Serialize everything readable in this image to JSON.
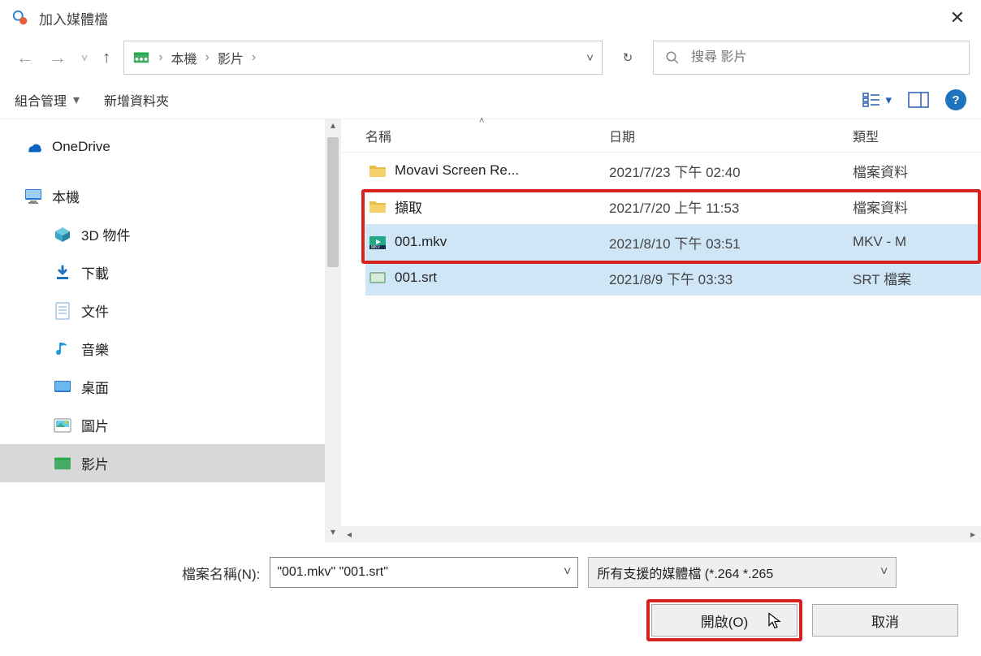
{
  "title": "加入媒體檔",
  "breadcrumbs": {
    "a": "本機",
    "b": "影片"
  },
  "search": {
    "placeholder": "搜尋 影片"
  },
  "toolbar": {
    "organize": "組合管理",
    "newfolder": "新增資料夾"
  },
  "columns": {
    "name": "名稱",
    "date": "日期",
    "type": "類型"
  },
  "sidebar": {
    "onedrive": "OneDrive",
    "thispc": "本機",
    "items": [
      "3D 物件",
      "下載",
      "文件",
      "音樂",
      "桌面",
      "圖片",
      "影片"
    ]
  },
  "files": [
    {
      "name": "Movavi Screen Re...",
      "date": "2021/7/23 下午 02:40",
      "type": "檔案資料",
      "kind": "folder",
      "sel": false
    },
    {
      "name": "擷取",
      "date": "2021/7/20 上午 11:53",
      "type": "檔案資料",
      "kind": "folder",
      "sel": false
    },
    {
      "name": "001.mkv",
      "date": "2021/8/10 下午 03:51",
      "type": "MKV - M",
      "kind": "mkv",
      "sel": true
    },
    {
      "name": "001.srt",
      "date": "2021/8/9 下午 03:33",
      "type": "SRT 檔案",
      "kind": "srt",
      "sel": true
    }
  ],
  "footer": {
    "filename_label": "檔案名稱(N):",
    "filename_value": "\"001.mkv\" \"001.srt\"",
    "filter_value": "所有支援的媒體檔 (*.264 *.265",
    "open": "開啟(O)",
    "cancel": "取消"
  }
}
